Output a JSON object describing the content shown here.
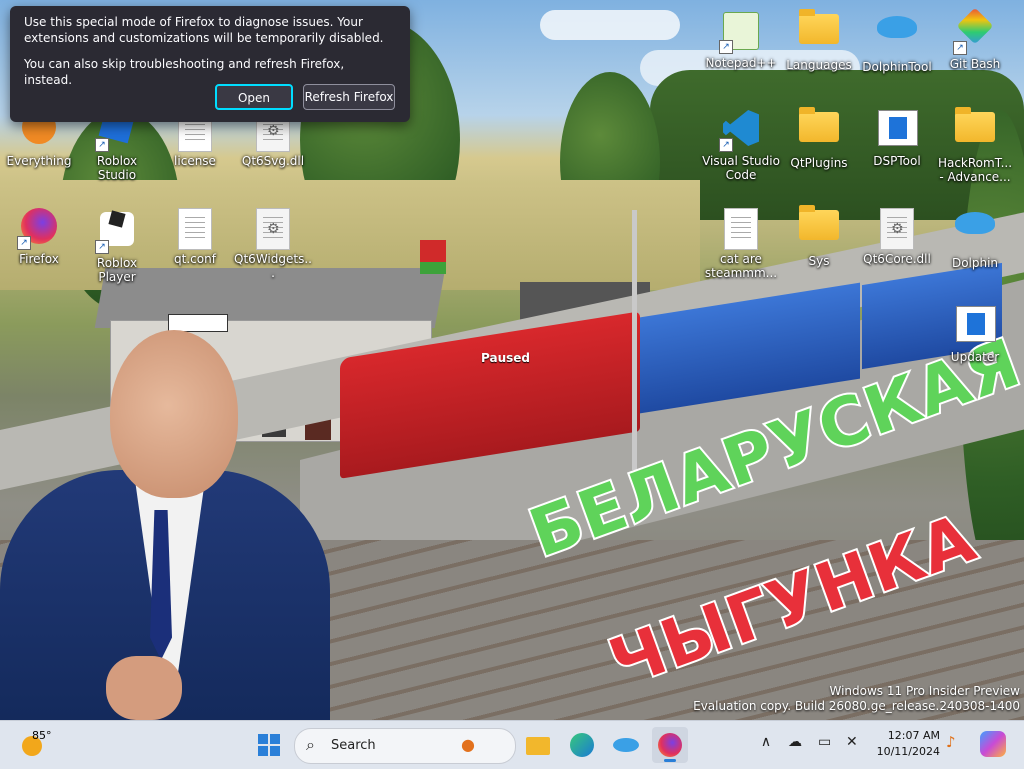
{
  "dialog": {
    "message1": "Use this special mode of Firefox to diagnose issues. Your extensions and customizations will be temporarily disabled.",
    "message2": "You can also skip troubleshooting and refresh Firefox, instead.",
    "open_label": "Open",
    "refresh_label": "Refresh Firefox"
  },
  "desktop_icons": {
    "everything": "Everything",
    "roblox_studio": "Roblox Studio",
    "license": "license",
    "qt6svg": "Qt6Svg.dll",
    "firefox": "Firefox",
    "roblox_player": "Roblox Player",
    "qtconf": "qt.conf",
    "qt6widgets": "Qt6Widgets...",
    "notepadpp": "Notepad++",
    "languages": "Languages",
    "dolphintool": "DolphinTool",
    "gitbash": "Git Bash",
    "vscode": "Visual Studio Code",
    "qtplugins": "QtPlugins",
    "dsptool": "DSPTool",
    "hackromtool": "HackRomT... - Advance...",
    "catare": "cat are steammm...",
    "sys": "Sys",
    "qt6core": "Qt6Core.dll",
    "dolphin": "Dolphin",
    "updater": "Updater"
  },
  "wallpaper": {
    "paused_label": "Paused",
    "line1": "БЕЛАРУСКАЯ",
    "line2": "ЧЫГУНКА",
    "line1_color": "#5fd35a",
    "line2_color": "#e8303a"
  },
  "watermark": {
    "line1": "Windows 11 Pro Insider Preview",
    "line2": "Evaluation copy. Build 26080.ge_release.240308-1400"
  },
  "taskbar": {
    "weather_temp": "85°",
    "search_placeholder": "Search",
    "time": "12:07 AM",
    "date": "10/11/2024",
    "color": "#dfe5ee"
  }
}
